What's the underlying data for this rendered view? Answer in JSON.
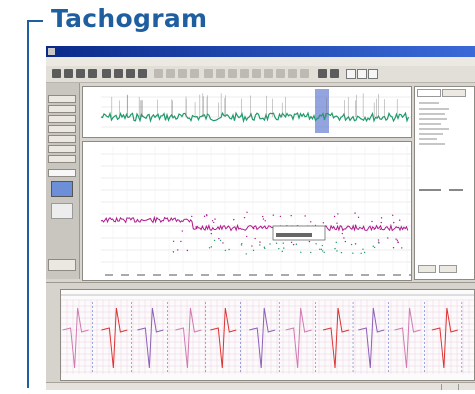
{
  "page": {
    "heading": "Tachogram"
  },
  "window": {
    "title": "",
    "menu": [
      "",
      "",
      "",
      "",
      "",
      ""
    ]
  },
  "toolbar_icons": [
    "new-icon",
    "open-icon",
    "save-icon",
    "edit-icon",
    "print-icon",
    "zoom-icon",
    "select-icon",
    "find-icon",
    "measure-icon",
    "range-icon",
    "mark-icon",
    "note-icon",
    "back-icon",
    "forward-icon",
    "view-icon",
    "view-icon",
    "view-icon"
  ],
  "colors": {
    "heading": "#1f5fa0",
    "titlebar": "#0a2a8a",
    "trace_green": "#1f9a6a",
    "trace_magenta": "#b0198c",
    "highlight": "#6f86d6",
    "grid": "#d9d9d9"
  }
}
